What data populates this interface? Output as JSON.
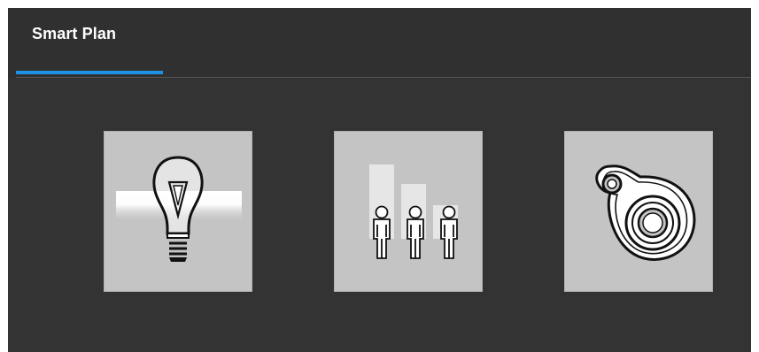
{
  "header": {
    "tabs": [
      {
        "label": "Smart Plan",
        "active": true
      }
    ],
    "accent_color": "#1e90e5"
  },
  "tiles": [
    {
      "icon": "lightbulb-icon"
    },
    {
      "icon": "people-growth-chart-icon"
    },
    {
      "icon": "target-tag-icon"
    }
  ],
  "colors": {
    "panel_background": "#333333",
    "tile_background": "#c4c4c4",
    "tab_text": "#ffffff"
  }
}
